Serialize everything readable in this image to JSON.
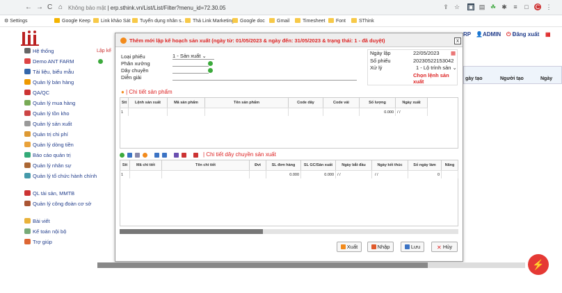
{
  "browser": {
    "url_prefix": "Không bảo mật",
    "url": "erp.sthink.vn/List/List/Filter?menu_id=72.30.05",
    "nav": {
      "back": "←",
      "forward": "→",
      "reload": "C",
      "home": "⌂"
    },
    "bookmarks": [
      "Settings",
      "Google Keep",
      "Link khảo Sát",
      "Tuyển dụng nhân s..",
      "Thả Link Marketing",
      "Google doc",
      "Gmail",
      "Timesheet",
      "Font",
      "SThink"
    ]
  },
  "sidebar": {
    "items": [
      {
        "label": "Hệ thống",
        "color": "#666"
      },
      {
        "label": "Demo ANT FARM",
        "color": "#d44"
      },
      {
        "label": "Tài liệu, biểu mẫu",
        "color": "#36a"
      },
      {
        "label": "Quản lý bán hàng",
        "color": "#e90"
      },
      {
        "label": "QA/QC",
        "color": "#c33"
      },
      {
        "label": "Quản lý mua hàng",
        "color": "#7a5"
      },
      {
        "label": "Quản lý tồn kho",
        "color": "#c44"
      },
      {
        "label": "Quản lý sản xuất",
        "color": "#999"
      },
      {
        "label": "Quản trị chi phí",
        "color": "#d93"
      },
      {
        "label": "Quản lý dòng tiền",
        "color": "#e9a23a"
      },
      {
        "label": "Báo cáo quản trị",
        "color": "#3a7"
      },
      {
        "label": "Quản lý nhân sự",
        "color": "#a63"
      },
      {
        "label": "Quản lý tổ chức hành chính",
        "color": "#49a"
      },
      {
        "label": "QL tài sản, MMTB",
        "color": "#c33"
      },
      {
        "label": "Quản lý công đoàn cơ sở",
        "color": "#a53"
      },
      {
        "label": "Bài viết",
        "color": "#e9b23a"
      },
      {
        "label": "Kế toán nội bộ",
        "color": "#7a7"
      },
      {
        "label": "Trợ giúp",
        "color": "#d63"
      }
    ]
  },
  "topright": {
    "rp": "RP",
    "admin": "ADMIN",
    "logout": "Đăng xuất"
  },
  "bg": {
    "title": "Lập kế",
    "col1": "gày tạo",
    "col2": "Người tạo",
    "col3": "Ngày"
  },
  "dialog": {
    "title": "Thêm mới lập kế hoạch sản xuất (ngày từ: 01/05/2023 & ngày đến: 31/05/2023 & trạng thái: 1 - đã duyệt)",
    "close": "x",
    "form": {
      "loai_phieu_label": "Loại phiếu",
      "loai_phieu_value": "1 - Sản xuất",
      "phan_xuong_label": "Phân xưởng",
      "day_chuyen_label": "Dây chuyền",
      "dien_giai_label": "Diễn giải",
      "ngay_lap_label": "Ngày lập",
      "ngay_lap_value": "22/05/2023",
      "so_phieu_label": "Số phiếu",
      "so_phieu_value": "20230522153042",
      "xu_ly_label": "Xử lý",
      "xu_ly_value": "1 - Lộ trình sản",
      "chon_lenh": "Chọn lệnh sản xuất"
    },
    "section1": "Chi tiết sản phẩm",
    "table1": {
      "headers": [
        "Stt",
        "Lệnh sản xuất",
        "Mã sản phẩm",
        "Tên sản phẩm",
        "Code dây",
        "Code vải",
        "Số lượng",
        "Ngày xuất"
      ],
      "row": [
        "1",
        "",
        "",
        "",
        "",
        "",
        "0.000",
        "/ /"
      ]
    },
    "section2": "Chi tiết dây chuyền sản xuất",
    "table2": {
      "headers": [
        "Stt",
        "Mã chi tiết",
        "Tên chi tiết",
        "Đvt",
        "SL đơn hàng",
        "SL GC/Sản xuất",
        "Ngày bắt đầu",
        "Ngày kết thúc",
        "Số ngày làm",
        "Năng"
      ],
      "row": [
        "1",
        "",
        "",
        "",
        "0.000",
        "0.000",
        "/ /",
        "/ /",
        "0",
        ""
      ]
    },
    "buttons": {
      "export": "Xuất",
      "import": "Nhập",
      "save": "Lưu",
      "cancel": "Hủy"
    }
  }
}
